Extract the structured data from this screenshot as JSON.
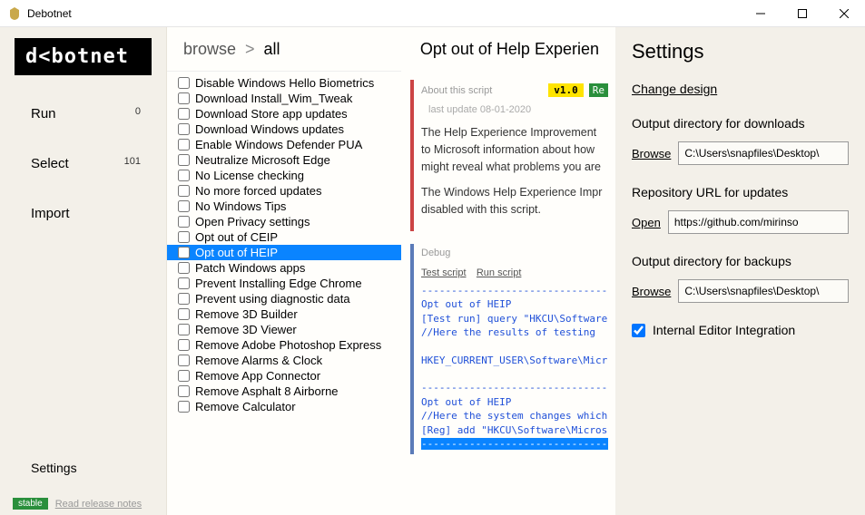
{
  "window": {
    "title": "Debotnet"
  },
  "logo": "d<botnet",
  "sidebar": {
    "run": {
      "label": "Run",
      "count": "0"
    },
    "select": {
      "label": "Select",
      "count": "101"
    },
    "import": {
      "label": "Import"
    },
    "settings": {
      "label": "Settings"
    }
  },
  "breadcrumb": {
    "root": "browse",
    "current": "all"
  },
  "page_title": "Opt out of Help Experien",
  "scripts": [
    "Disable Windows Hello Biometrics",
    "Download Install_Wim_Tweak",
    "Download Store app updates",
    "Download Windows updates",
    "Enable Windows Defender PUA",
    "Neutralize Microsoft Edge",
    "No License checking",
    "No more forced updates",
    "No Windows Tips",
    "Open Privacy settings",
    "Opt out of CEIP",
    "Opt out of HEIP",
    "Patch Windows apps",
    "Prevent Installing Edge Chrome",
    "Prevent using diagnostic data",
    "Remove 3D Builder",
    "Remove 3D Viewer",
    "Remove Adobe Photoshop Express",
    "Remove Alarms & Clock",
    "Remove App Connector",
    "Remove Asphalt 8 Airborne",
    "Remove Calculator"
  ],
  "selected_index": 11,
  "about": {
    "label": "About this script",
    "version": "v1.0",
    "re": "Re",
    "last_update": "last update 08-01-2020",
    "p1": "The Help Experience Improvement to Microsoft information about how might reveal what problems you are",
    "p2": "The Windows Help Experience Impr disabled with this script."
  },
  "debug": {
    "label": "Debug",
    "test": "Test script",
    "run": "Run script",
    "line_dash": "--------------------------------",
    "l1": "Opt out of HEIP",
    "l2": "[Test run] query \"HKCU\\Software\\",
    "l3": "//Here the results of testing",
    "l4": "HKEY_CURRENT_USER\\Software\\Micro",
    "l5": "Opt out of HEIP",
    "l6": "//Here the system changes which",
    "l7": "[Reg] add \"HKCU\\Software\\Microso"
  },
  "settings": {
    "title": "Settings",
    "change_design": "Change design",
    "out_dl_label": "Output directory for downloads",
    "browse": "Browse",
    "open": "Open",
    "out_dl_val": "C:\\Users\\snapfiles\\Desktop\\",
    "repo_label": "Repository URL for updates",
    "repo_val": "https://github.com/mirinso",
    "out_bk_label": "Output directory for backups",
    "out_bk_val": "C:\\Users\\snapfiles\\Desktop\\",
    "editor_chk": "Internal Editor Integration"
  },
  "footer": {
    "stable": "stable",
    "notes": "Read release notes"
  }
}
